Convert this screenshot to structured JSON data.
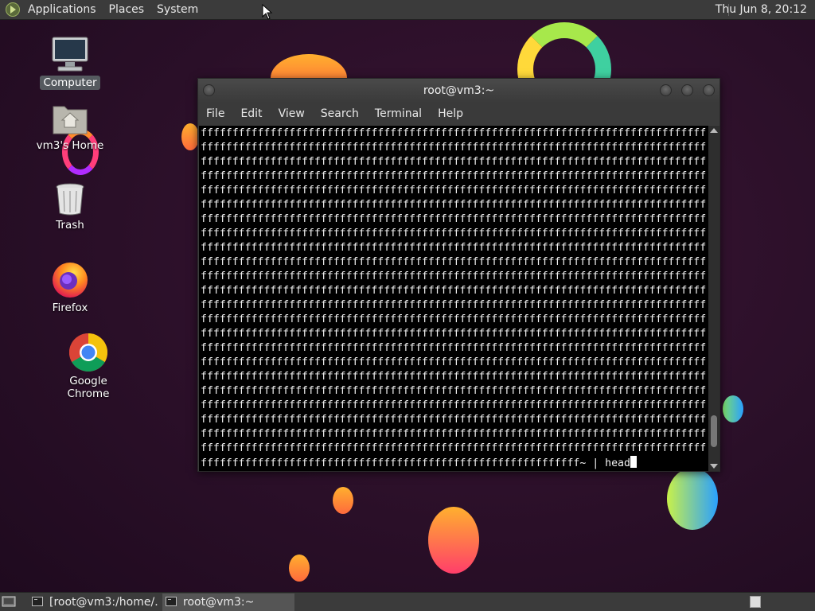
{
  "top_panel": {
    "menus": [
      "Applications",
      "Places",
      "System"
    ],
    "clock": "Thu Jun  8, 20:12"
  },
  "desktop_icons": [
    {
      "label": "Computer",
      "icon": "computer-icon"
    },
    {
      "label": "vm3's Home",
      "icon": "home-folder-icon"
    },
    {
      "label": "Trash",
      "icon": "trash-icon"
    },
    {
      "label": "Firefox",
      "icon": "firefox-icon"
    },
    {
      "label": "Google Chrome",
      "icon": "chrome-icon"
    }
  ],
  "terminal": {
    "title": "root@vm3:~",
    "menu": [
      "File",
      "Edit",
      "View",
      "Search",
      "Terminal",
      "Help"
    ],
    "full_line": "ffffffffffffffffffffffffffffffffffffffffffffffffffffffffffffffffffffffffffffffff",
    "full_line_count": 23,
    "last_line": "ffffffffffffffffffffffffffffffffffffffffffffffffffffffffffff~ | head",
    "scroll_position": 0.95
  },
  "taskbar": {
    "tasks": [
      {
        "label": "[root@vm3:/home/...",
        "active": false
      },
      {
        "label": "root@vm3:~",
        "active": true
      }
    ]
  },
  "colors": {
    "panel": "#3b3b3b",
    "terminal_bg": "#000000",
    "terminal_fg": "#f2f2f2",
    "desktop_bg": "#2a0f28"
  }
}
